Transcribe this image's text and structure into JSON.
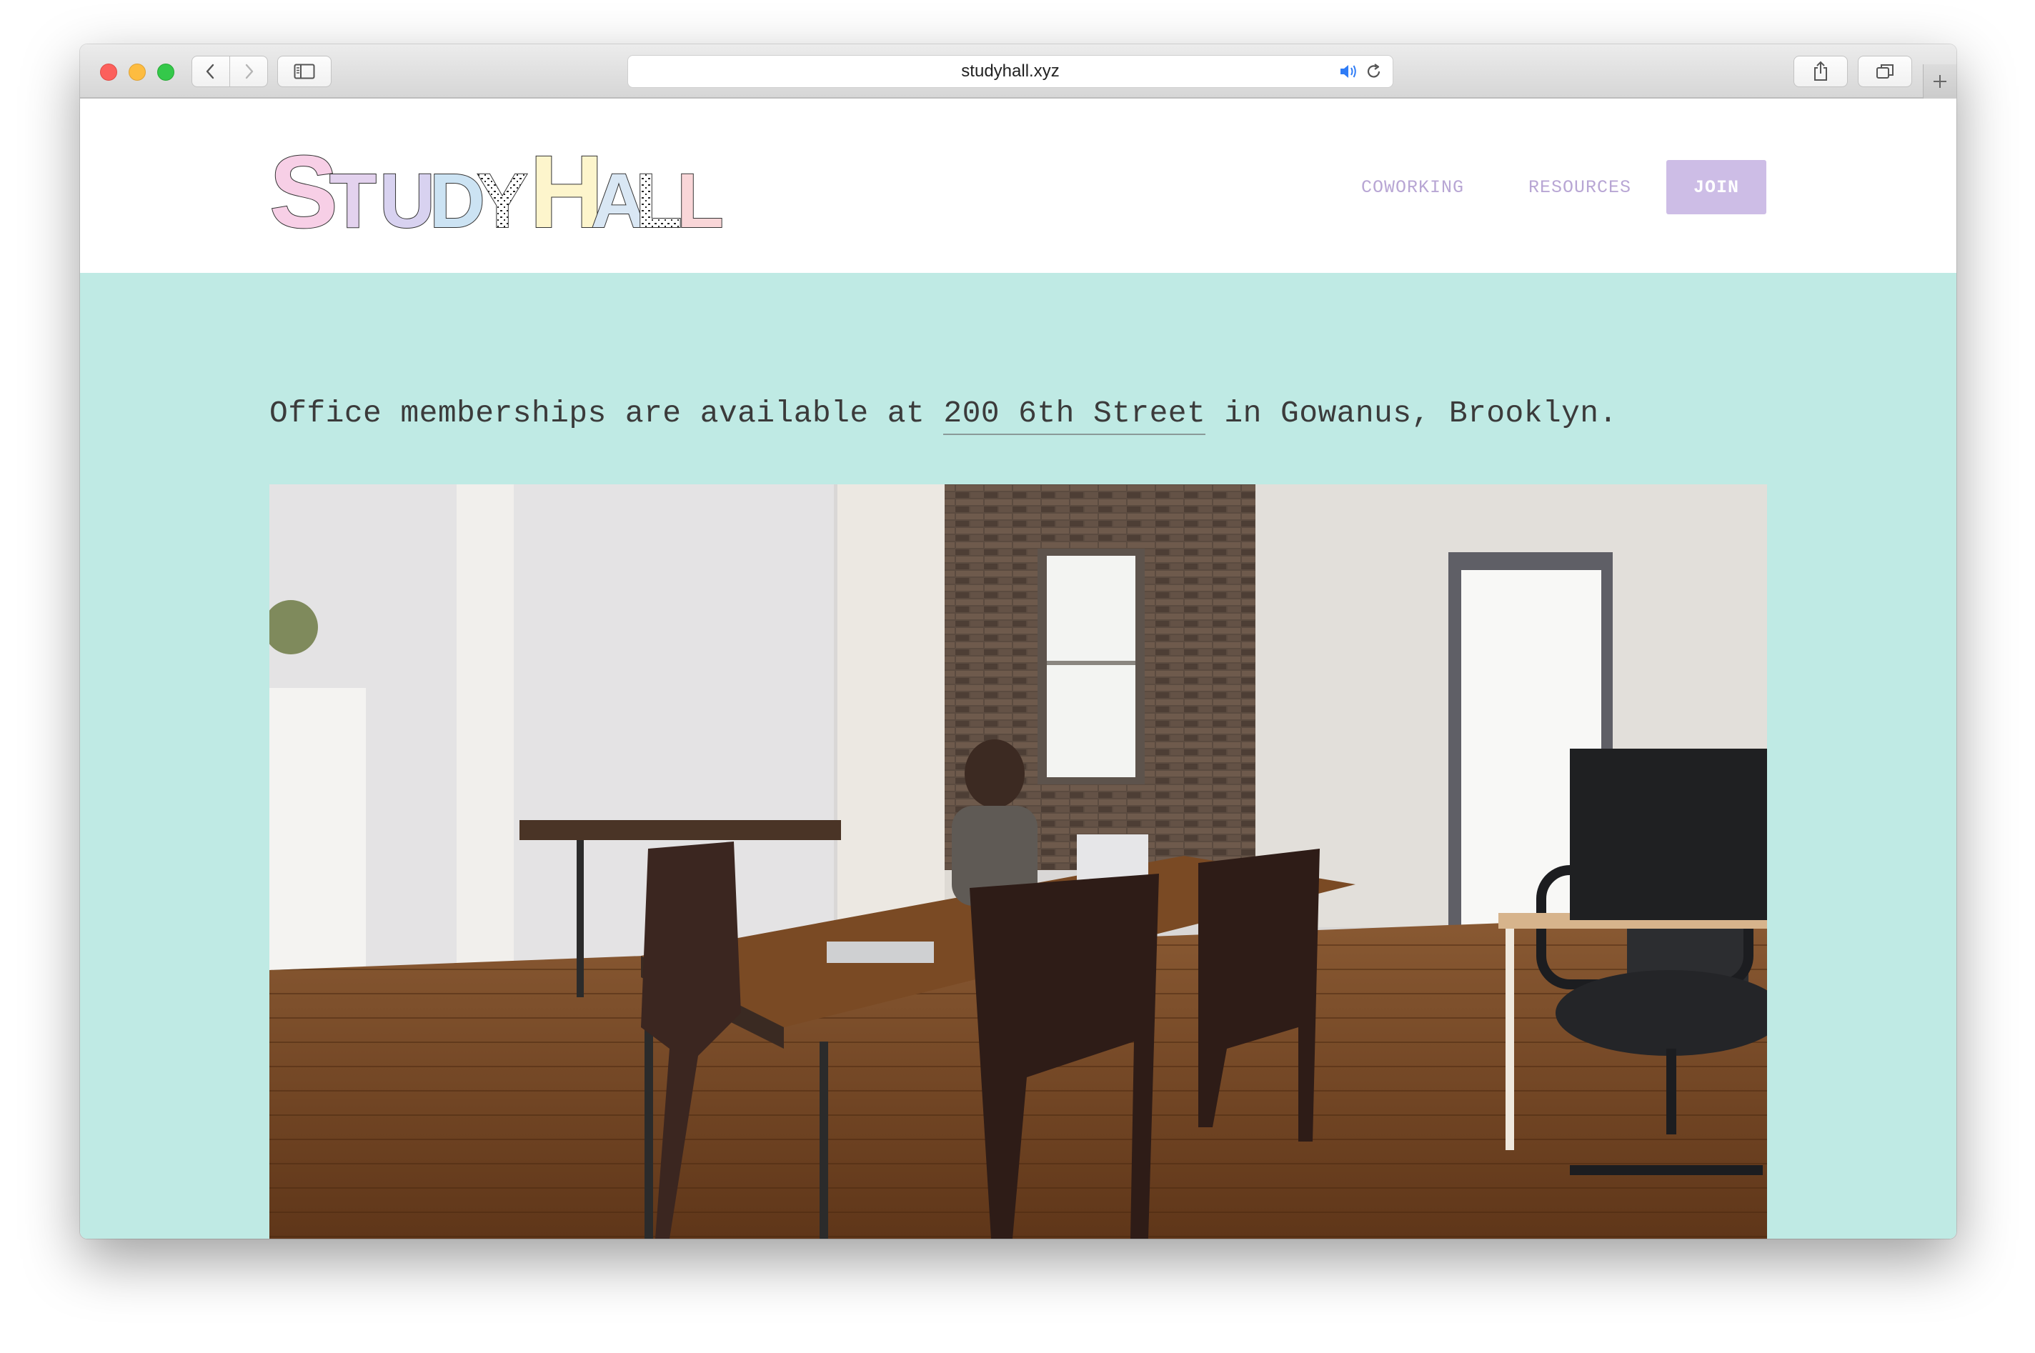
{
  "browser": {
    "url": "studyhall.xyz"
  },
  "site": {
    "logo_text": "STUDY HALL",
    "nav": [
      {
        "label": "COWORKING"
      },
      {
        "label": "RESOURCES"
      }
    ],
    "join_label": "JOIN"
  },
  "hero": {
    "tagline_before": "Office memberships are available at ",
    "tagline_link": "200 6th Street",
    "tagline_after": " in Gowanus, Brooklyn.",
    "photo_subject": "coworking office with wooden tables, chairs and a person working on a laptop"
  },
  "colors": {
    "hero_bg": "#bfeae4",
    "nav_text": "#b8a6d4",
    "join_bg": "#cdbde6",
    "tagline_text": "#3b3b3b"
  }
}
